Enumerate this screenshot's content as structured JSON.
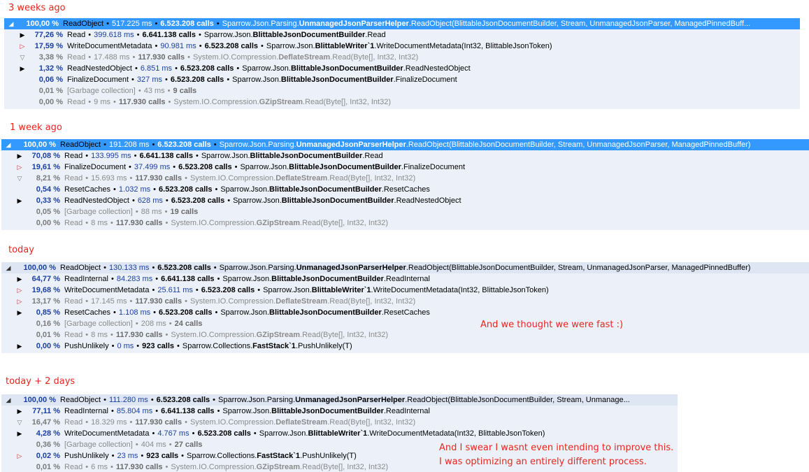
{
  "labels": {
    "weeks3": "3 weeks ago",
    "week1": "1 week ago",
    "today": "today",
    "today2": "today + 2 days"
  },
  "notes": {
    "today": "And we thought we were fast :)",
    "today2_line1": "And I swear I wasnt even intending to improve this.",
    "today2_line2": "I was optimizing an entirely different process."
  },
  "panels": {
    "weeks3": [
      {
        "icon": "◢",
        "pct": "100,00 %",
        "name": "ReadObject",
        "ms": "517.225 ms",
        "calls": "6.523.208 calls",
        "ns": "Sparrow.Json.Parsing.",
        "cls": "UnmanagedJsonParserHelper",
        "sig": ".ReadObject(BlittableJsonDocumentBuilder, Stream, UnmanagedJsonParser, ManagedPinnedBuff..."
      },
      {
        "icon": "▶",
        "pct": "77,26 %",
        "name": "Read",
        "ms": "399.618 ms",
        "calls": "6.641.138 calls",
        "ns": "Sparrow.Json.",
        "cls": "BlittableJsonDocumentBuilder",
        "sig": ".Read"
      },
      {
        "icon": "▷",
        "pct": "17,59 %",
        "name": "WriteDocumentMetadata",
        "ms": "90.981 ms",
        "calls": "6.523.208 calls",
        "ns": "Sparrow.Json.",
        "cls": "BlittableWriter`1",
        "sig": ".WriteDocumentMetadata(Int32, BlittableJsonToken)"
      },
      {
        "icon": "▽",
        "pct": "3,38 %",
        "name": "Read",
        "ms": "17.488 ms",
        "calls": "117.930 calls",
        "ns": "System.IO.Compression.",
        "cls": "DeflateStream",
        "sig": ".Read(Byte[], Int32, Int32)"
      },
      {
        "icon": "▶",
        "pct": "1,32 %",
        "name": "ReadNestedObject",
        "ms": "6.851 ms",
        "calls": "6.523.208 calls",
        "ns": "Sparrow.Json.",
        "cls": "BlittableJsonDocumentBuilder",
        "sig": ".ReadNestedObject"
      },
      {
        "icon": "",
        "pct": "0,06 %",
        "name": "FinalizeDocument",
        "ms": "327 ms",
        "calls": "6.523.208 calls",
        "ns": "Sparrow.Json.",
        "cls": "BlittableJsonDocumentBuilder",
        "sig": ".FinalizeDocument"
      },
      {
        "icon": "",
        "pct": "0,01 %",
        "name": "[Garbage collection]",
        "ms": "43 ms",
        "calls": "9 calls",
        "ns": "",
        "cls": "",
        "sig": ""
      },
      {
        "icon": "",
        "pct": "0,00 %",
        "name": "Read",
        "ms": "9 ms",
        "calls": "117.930 calls",
        "ns": "System.IO.Compression.",
        "cls": "GZipStream",
        "sig": ".Read(Byte[], Int32, Int32)"
      }
    ],
    "week1": [
      {
        "icon": "◢",
        "pct": "100,00 %",
        "name": "ReadObject",
        "ms": "191.208 ms",
        "calls": "6.523.208 calls",
        "ns": "Sparrow.Json.Parsing.",
        "cls": "UnmanagedJsonParserHelper",
        "sig": ".ReadObject(BlittableJsonDocumentBuilder, Stream, UnmanagedJsonParser, ManagedPinnedBuffer)"
      },
      {
        "icon": "▶",
        "pct": "70,08 %",
        "name": "Read",
        "ms": "133.995 ms",
        "calls": "6.641.138 calls",
        "ns": "Sparrow.Json.",
        "cls": "BlittableJsonDocumentBuilder",
        "sig": ".Read"
      },
      {
        "icon": "▷",
        "pct": "19,61 %",
        "name": "FinalizeDocument",
        "ms": "37.499 ms",
        "calls": "6.523.208 calls",
        "ns": "Sparrow.Json.",
        "cls": "BlittableJsonDocumentBuilder",
        "sig": ".FinalizeDocument"
      },
      {
        "icon": "▽",
        "pct": "8,21 %",
        "name": "Read",
        "ms": "15.693 ms",
        "calls": "117.930 calls",
        "ns": "System.IO.Compression.",
        "cls": "DeflateStream",
        "sig": ".Read(Byte[], Int32, Int32)"
      },
      {
        "icon": "",
        "pct": "0,54 %",
        "name": "ResetCaches",
        "ms": "1.032 ms",
        "calls": "6.523.208 calls",
        "ns": "Sparrow.Json.",
        "cls": "BlittableJsonDocumentBuilder",
        "sig": ".ResetCaches"
      },
      {
        "icon": "▶",
        "pct": "0,33 %",
        "name": "ReadNestedObject",
        "ms": "628 ms",
        "calls": "6.523.208 calls",
        "ns": "Sparrow.Json.",
        "cls": "BlittableJsonDocumentBuilder",
        "sig": ".ReadNestedObject"
      },
      {
        "icon": "",
        "pct": "0,05 %",
        "name": "[Garbage collection]",
        "ms": "88 ms",
        "calls": "19 calls",
        "ns": "",
        "cls": "",
        "sig": ""
      },
      {
        "icon": "",
        "pct": "0,00 %",
        "name": "Read",
        "ms": "8 ms",
        "calls": "117.930 calls",
        "ns": "System.IO.Compression.",
        "cls": "GZipStream",
        "sig": ".Read(Byte[], Int32, Int32)"
      }
    ],
    "today": [
      {
        "icon": "◢",
        "pct": "100,00 %",
        "name": "ReadObject",
        "ms": "130.133 ms",
        "calls": "6.523.208 calls",
        "ns": "Sparrow.Json.Parsing.",
        "cls": "UnmanagedJsonParserHelper",
        "sig": ".ReadObject(BlittableJsonDocumentBuilder, Stream, UnmanagedJsonParser, ManagedPinnedBuffer)"
      },
      {
        "icon": "▶",
        "pct": "64,77 %",
        "name": "ReadInternal",
        "ms": "84.283 ms",
        "calls": "6.641.138 calls",
        "ns": "Sparrow.Json.",
        "cls": "BlittableJsonDocumentBuilder",
        "sig": ".ReadInternal"
      },
      {
        "icon": "▷",
        "pct": "19,68 %",
        "name": "WriteDocumentMetadata",
        "ms": "25.611 ms",
        "calls": "6.523.208 calls",
        "ns": "Sparrow.Json.",
        "cls": "BlittableWriter`1",
        "sig": ".WriteDocumentMetadata(Int32, BlittableJsonToken)"
      },
      {
        "icon": "▷",
        "pct": "13,17 %",
        "name": "Read",
        "ms": "17.145 ms",
        "calls": "117.930 calls",
        "ns": "System.IO.Compression.",
        "cls": "DeflateStream",
        "sig": ".Read(Byte[], Int32, Int32)"
      },
      {
        "icon": "▶",
        "pct": "0,85 %",
        "name": "ResetCaches",
        "ms": "1.108 ms",
        "calls": "6.523.208 calls",
        "ns": "Sparrow.Json.",
        "cls": "BlittableJsonDocumentBuilder",
        "sig": ".ResetCaches"
      },
      {
        "icon": "",
        "pct": "0,16 %",
        "name": "[Garbage collection]",
        "ms": "208 ms",
        "calls": "24 calls",
        "ns": "",
        "cls": "",
        "sig": ""
      },
      {
        "icon": "",
        "pct": "0,01 %",
        "name": "Read",
        "ms": "8 ms",
        "calls": "117.930 calls",
        "ns": "System.IO.Compression.",
        "cls": "GZipStream",
        "sig": ".Read(Byte[], Int32, Int32)"
      },
      {
        "icon": "▶",
        "pct": "0,00 %",
        "name": "PushUnlikely",
        "ms": "0 ms",
        "calls": "923 calls",
        "ns": "Sparrow.Collections.",
        "cls": "FastStack`1",
        "sig": ".PushUnlikely(T)"
      }
    ],
    "today2": [
      {
        "icon": "◢",
        "pct": "100,00 %",
        "name": "ReadObject",
        "ms": "111.280 ms",
        "calls": "6.523.208 calls",
        "ns": "Sparrow.Json.Parsing.",
        "cls": "UnmanagedJsonParserHelper",
        "sig": ".ReadObject(BlittableJsonDocumentBuilder, Stream, Unmanage..."
      },
      {
        "icon": "▶",
        "pct": "77,11 %",
        "name": "ReadInternal",
        "ms": "85.804 ms",
        "calls": "6.641.138 calls",
        "ns": "Sparrow.Json.",
        "cls": "BlittableJsonDocumentBuilder",
        "sig": ".ReadInternal"
      },
      {
        "icon": "▽",
        "pct": "16,47 %",
        "name": "Read",
        "ms": "18.329 ms",
        "calls": "117.930 calls",
        "ns": "System.IO.Compression.",
        "cls": "DeflateStream",
        "sig": ".Read(Byte[], Int32, Int32)"
      },
      {
        "icon": "▶",
        "pct": "4,28 %",
        "name": "WriteDocumentMetadata",
        "ms": "4.767 ms",
        "calls": "6.523.208 calls",
        "ns": "Sparrow.Json.",
        "cls": "BlittableWriter`1",
        "sig": ".WriteDocumentMetadata(Int32, BlittableJsonToken)"
      },
      {
        "icon": "",
        "pct": "0,36 %",
        "name": "[Garbage collection]",
        "ms": "404 ms",
        "calls": "27 calls",
        "ns": "",
        "cls": "",
        "sig": ""
      },
      {
        "icon": "▷",
        "pct": "0,02 %",
        "name": "PushUnlikely",
        "ms": "23 ms",
        "calls": "923 calls",
        "ns": "Sparrow.Collections.",
        "cls": "FastStack`1",
        "sig": ".PushUnlikely(T)"
      },
      {
        "icon": "",
        "pct": "0,01 %",
        "name": "Read",
        "ms": "6 ms",
        "calls": "117.930 calls",
        "ns": "System.IO.Compression.",
        "cls": "GZipStream",
        "sig": ".Read(Byte[], Int32, Int32)"
      }
    ]
  },
  "colors": {
    "annotation_red": "#e8261e",
    "selection_blue": "#3399ff",
    "panel_bg": "#ecf1f9",
    "percent_blue": "#1a3fa0"
  }
}
